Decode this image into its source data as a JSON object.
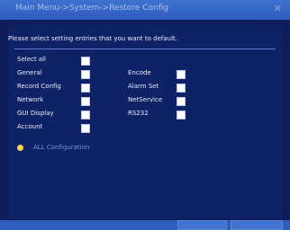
{
  "title": "Main Menu->System->Restore Config",
  "close_glyph": "✕",
  "instruction": "Please select setting entries that you want to default.",
  "select_all_label": "Select all",
  "entries": {
    "general": "General",
    "record_config": "Record Config",
    "network": "Network",
    "gui_display": "GUI Display",
    "account": "Account",
    "encode": "Encode",
    "alarm_set": "Alarm Set",
    "netservice": "NetService",
    "rs232": "RS232"
  },
  "all_configurations": "ALL Configuration",
  "buttons": {
    "ok": "",
    "cancel": ""
  },
  "colors": {
    "title_bar": "#3f73cf",
    "background": "#0f1e5a",
    "bullet": "#f0d64a"
  }
}
